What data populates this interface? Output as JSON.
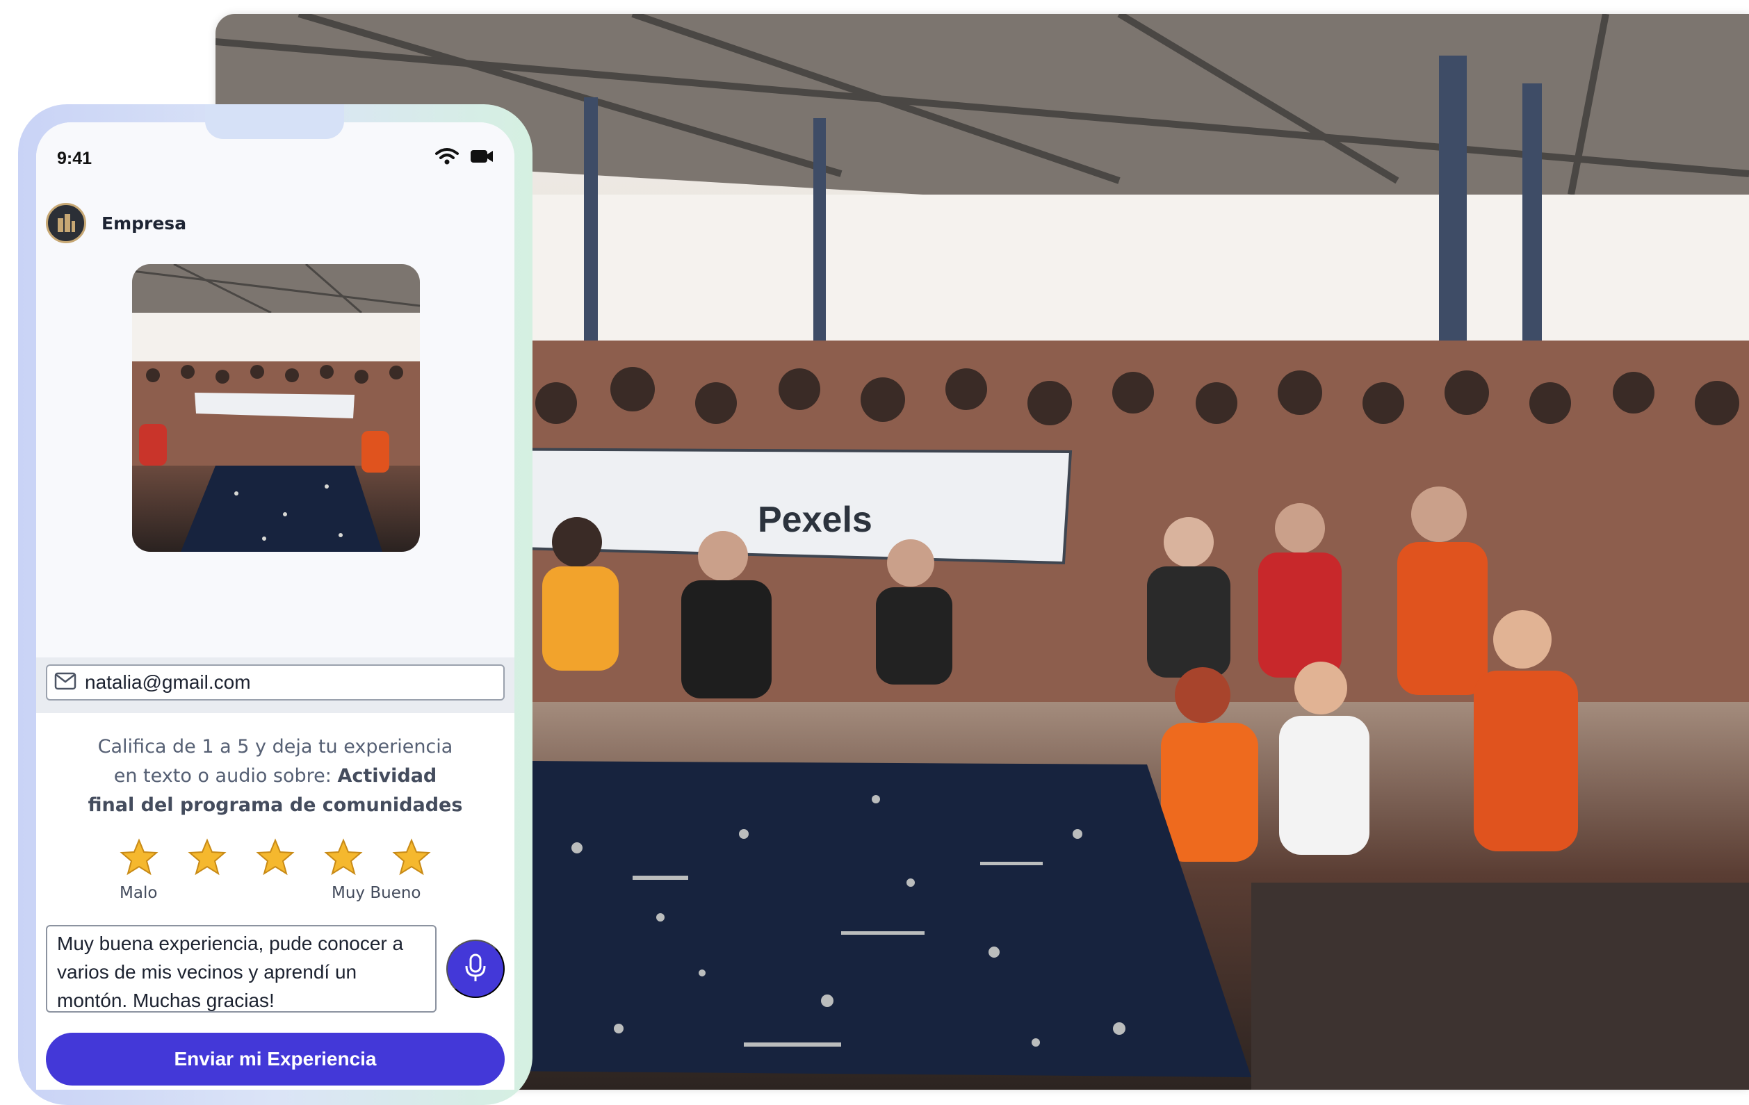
{
  "status_bar": {
    "time": "9:41",
    "icons": [
      "wifi-icon",
      "camera-icon"
    ]
  },
  "company": {
    "name": "Empresa",
    "avatar_icon": "building-icon"
  },
  "photo": {
    "banner_text": "Pexels"
  },
  "form": {
    "email_icon": "mail-icon",
    "email_value": "natalia@gmail.com",
    "prompt_line1": "Califica de 1 a 5 y deja tu experiencia",
    "prompt_line2_prefix": "en texto o audio sobre: ",
    "prompt_activity_part1": "Actividad",
    "prompt_activity_part2": "final del programa de comunidades",
    "rating_scale": {
      "min": 1,
      "max": 5,
      "selected": 5
    },
    "scale_low_label": "Malo",
    "scale_high_label": "Muy Bueno",
    "feedback_text": "Muy buena experiencia, pude conocer a varios de mis vecinos y aprendí un montón. Muchas gracias!",
    "mic_icon": "microphone-icon",
    "submit_label": "Enviar mi Experiencia"
  },
  "colors": {
    "accent": "#4338d8",
    "star": "#f5b82e",
    "text_muted": "#566074"
  }
}
